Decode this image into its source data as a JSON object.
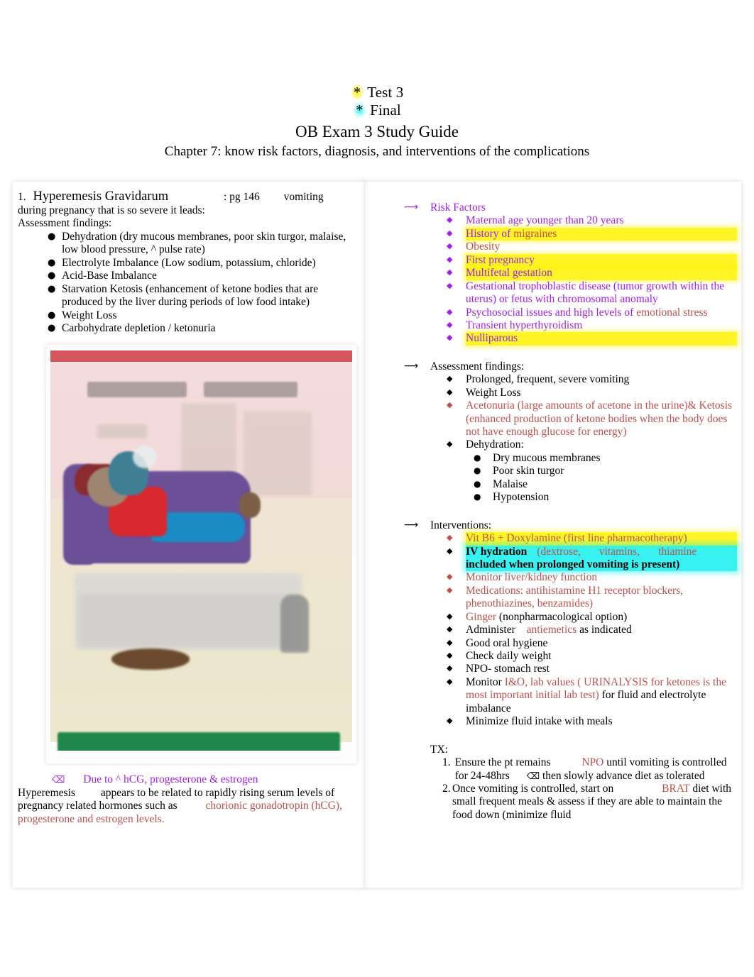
{
  "header": {
    "line1_star": "*",
    "line1_text": " Test 3",
    "line2_star": "*",
    "line2_text": " Final",
    "title": "OB Exam 3 Study Guide",
    "subtitle": "Chapter 7: know risk factors, diagnosis, and interventions of the complications"
  },
  "left_column": {
    "heading_number": "1.",
    "heading_title": "Hyperemesis Gravidarum",
    "heading_page": ": pg 146",
    "heading_tail": "vomiting",
    "intro_line2": "during pregnancy that is so severe it leads:",
    "assessment_label": "Assessment findings:",
    "assessment_items": [
      "Dehydration (dry mucous membranes, poor skin turgor, malaise, low blood pressure, ^ pulse rate)",
      "Electrolyte Imbalance (Low sodium, potassium, chloride)",
      "Acid-Base Imbalance",
      "Starvation Ketosis (enhancement of ketone bodies that are produced by the liver during periods of low food intake)",
      "Weight Loss",
      "Carbohydrate depletion / ketonuria"
    ],
    "illustration_name": "hyperemesis-gravidarum-infographic",
    "footer_bullet_glyph": "⌫",
    "footer_bullet_purple": "Due to ^ hCG, progesterone & estrogen",
    "footer_black_1": "Hyperemesis",
    "footer_black_2": "appears to be related to rapidly rising serum levels of pregnancy related hormones such as",
    "footer_red": "chorionic gonadotropin (hCG), progesterone and estrogen levels."
  },
  "right_column": {
    "risk_factors": {
      "heading": "Risk Factors",
      "items": [
        {
          "text": "Maternal age younger than 20 years",
          "color": "purple",
          "highlight": "none"
        },
        {
          "text": "History of migraines",
          "color": "purple-brown",
          "part1": "History of ",
          "part2": "migraines",
          "highlight": "yellow"
        },
        {
          "text": "Obesity",
          "color": "brown",
          "highlight": "none"
        },
        {
          "text": "First pregnancy",
          "color": "purple",
          "highlight": "yellow"
        },
        {
          "text": "Multifetal gestation",
          "color": "purple",
          "highlight": "yellow"
        },
        {
          "text": "Gestational trophoblastic disease (tumor growth within the uterus) or fetus with chromosomal anomaly",
          "color": "purple",
          "highlight": "none"
        },
        {
          "text": "Psychosocial issues and high levels of emotional stress",
          "part1": "Psychosocial issues and high levels of ",
          "part2": "emotional stress",
          "color": "purple-brown",
          "highlight": "none"
        },
        {
          "text": "Transient hyperthyroidism",
          "color": "purple",
          "highlight": "none"
        },
        {
          "text": "Nulliparous",
          "color": "purple",
          "highlight": "yellow"
        }
      ]
    },
    "assessment": {
      "heading": "Assessment findings:",
      "items": [
        {
          "text": "Prolonged, frequent, severe vomiting",
          "color": "black"
        },
        {
          "text": "Weight Loss",
          "color": "black"
        },
        {
          "text": "Acetonuria      (large amounts of acetone in the urine)&   Ketosis      (enhanced production of ketone bodies when the body does not have enough glucose for energy)",
          "color": "red"
        },
        {
          "text": "Dehydration:",
          "color": "black"
        }
      ],
      "dehydration_sub": [
        "Dry mucous membranes",
        "Poor skin turgor",
        "Malaise",
        "Hypotension"
      ]
    },
    "interventions": {
      "heading": "Interventions:",
      "items": [
        {
          "text": "Vit B6 + Doxylamine (first line pharmacotherapy)",
          "color": "red",
          "highlight": "yellow"
        },
        {
          "bold_part": "IV hydration",
          "red_part_a": "(dextrose,",
          "red_part_b": "vitamins,",
          "red_part_c": "thiamine",
          "bold_part_b": "included when prolonged vomiting is present)",
          "color": "mixed",
          "highlight": "cyan"
        },
        {
          "text": "Monitor liver/kidney function",
          "color": "red"
        },
        {
          "text": "Medications: antihistamine H1 receptor blockers, phenothiazines, benzamides)",
          "color": "red"
        },
        {
          "part1": "Ginger",
          "part2": "   (nonpharmacological option)",
          "color": "red-black"
        },
        {
          "part1": "Administer  ",
          "part2": "antiemetics",
          "part3": "    as indicated",
          "color": "black-red-black"
        },
        {
          "text": "Good oral hygiene",
          "color": "black"
        },
        {
          "text": "Check daily weight",
          "color": "black"
        },
        {
          "text": "NPO- stomach rest",
          "color": "black"
        },
        {
          "part1": "Monitor ",
          "part2": "  I&O, lab values (     URINALYSIS     for ketones is the most important initial lab test)",
          "part3": "          for fluid and electrolyte imbalance",
          "color": "black-red-black"
        },
        {
          "text": "Minimize fluid intake with meals",
          "color": "black"
        }
      ]
    },
    "tx": {
      "label": "TX:",
      "items": [
        {
          "num": "1.",
          "a": "Ensure the pt remains ",
          "red": "NPO",
          "b": " until vomiting is controlled for 24-48hrs ",
          "glyph": "⌫",
          "c": " then slowly advance diet as tolerated"
        },
        {
          "num": "2.",
          "a": "Once vomiting is controlled, start on ",
          "red": "BRAT",
          "b": " diet with small frequent meals & assess if they are able to maintain the food down (minimize fluid"
        }
      ]
    }
  },
  "colors": {
    "red": "#c0504d",
    "purple": "#a020f0",
    "highlight_yellow": "#fff200",
    "highlight_cyan": "#00eeee"
  }
}
